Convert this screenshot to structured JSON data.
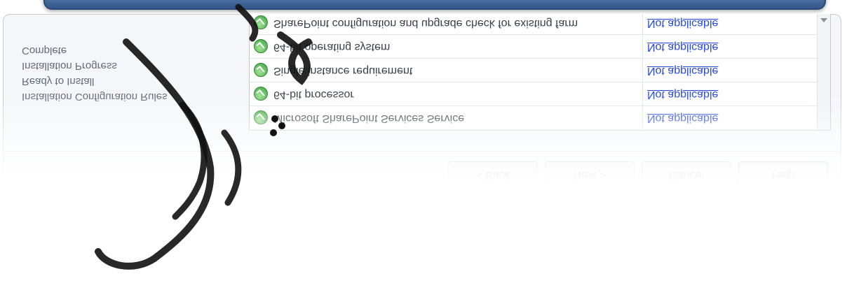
{
  "buttons": {
    "back": "< Back",
    "next": "Next >",
    "cancel": "Cancel",
    "help": "Help"
  },
  "steps": [
    "Complete",
    "Installation Progress",
    "Ready to Install",
    "Installation Configuration Rules"
  ],
  "feature_rules": [
    {
      "name": "SharePoint configuration and upgrade check for existing farm",
      "status": "Not applicable"
    },
    {
      "name": "64-bit operating system",
      "status": "Not applicable"
    },
    {
      "name": "Single instance requirement",
      "status": "Not applicable"
    },
    {
      "name": "64-bit processor",
      "status": "Not applicable"
    },
    {
      "name": "Microsoft SharePoint Services Service",
      "status": "Not applicable"
    }
  ],
  "colors": {
    "frame_blue": "#34578a",
    "link_blue": "#1a3ed8",
    "ok_green": "#2f9a35",
    "watermark": "#000000"
  },
  "icons": [
    "check-icon",
    "scroll-up-icon"
  ]
}
